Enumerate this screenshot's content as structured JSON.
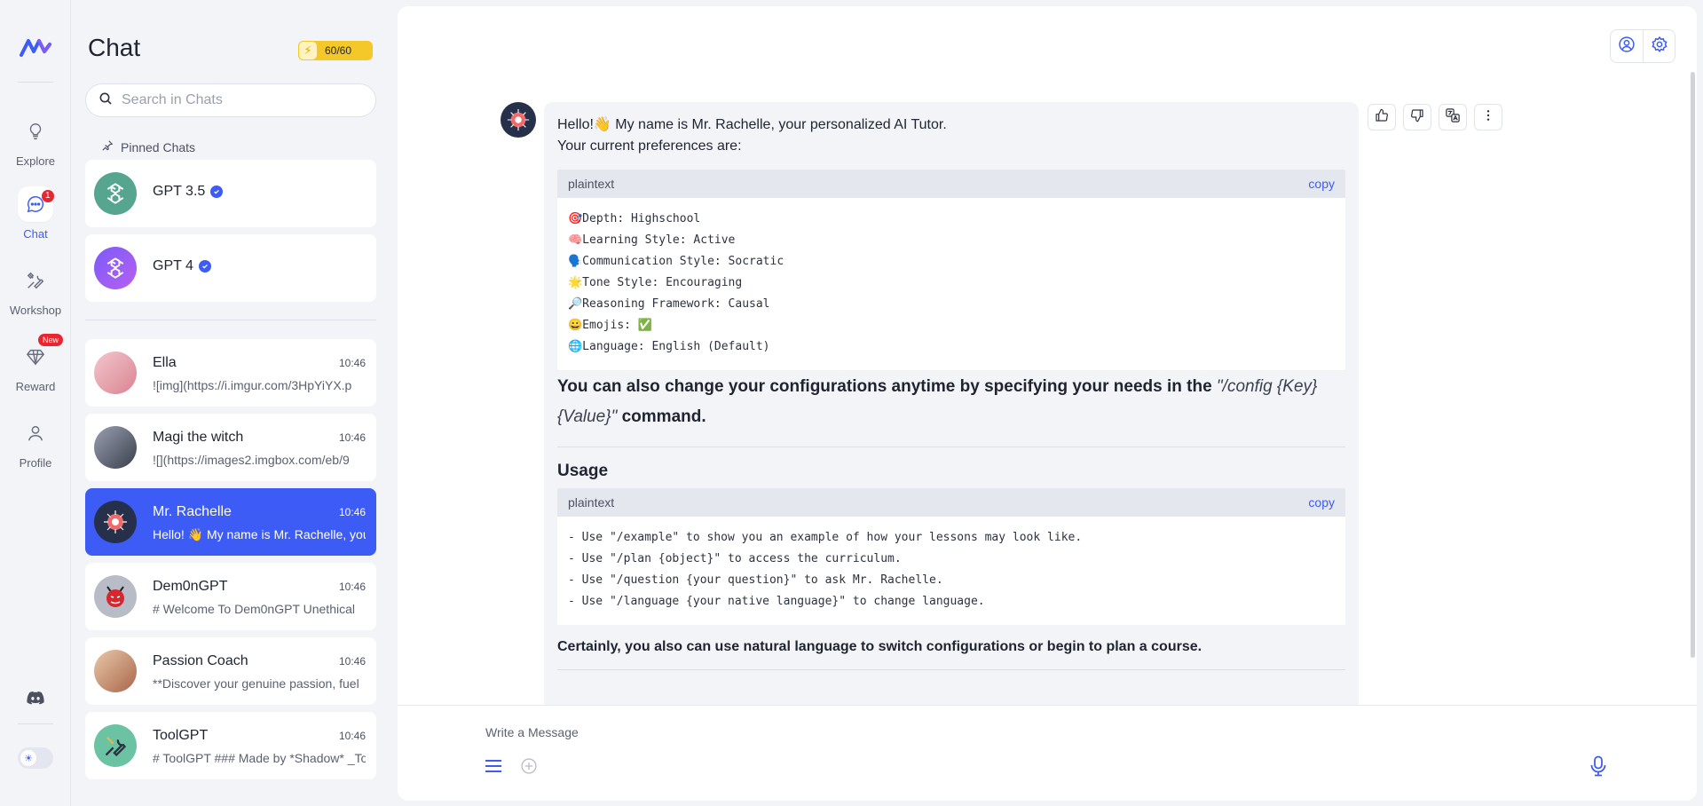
{
  "brand": {
    "logo": "app-logo",
    "accent": "#3d5bf5"
  },
  "rail": {
    "items": [
      {
        "label": "Explore",
        "icon": "lightbulb-icon"
      },
      {
        "label": "Chat",
        "icon": "chat-bubble-icon",
        "badge": "1"
      },
      {
        "label": "Workshop",
        "icon": "tools-icon"
      },
      {
        "label": "Reward",
        "icon": "diamond-icon",
        "badge": "New"
      },
      {
        "label": "Profile",
        "icon": "user-icon"
      }
    ],
    "discord_icon": "discord-icon",
    "theme_icon": "sun-icon"
  },
  "panel": {
    "title": "Chat",
    "quota": "60/60",
    "search_placeholder": "Search in Chats",
    "pinned_label": "Pinned Chats",
    "pinned": [
      {
        "name": "GPT 3.5",
        "verified": true
      },
      {
        "name": "GPT 4",
        "verified": true
      }
    ],
    "chats": [
      {
        "name": "Ella",
        "time": "10:46",
        "preview": "![img](https://i.imgur.com/3HpYiYX.p"
      },
      {
        "name": "Magi the witch",
        "time": "10:46",
        "preview": "![](https://images2.imgbox.com/eb/9"
      },
      {
        "name": "Mr. Rachelle",
        "time": "10:46",
        "preview": "Hello! 👋 My name is Mr. Rachelle, you",
        "active": true
      },
      {
        "name": "Dem0nGPT",
        "time": "10:46",
        "preview": "# Welcome To Dem0nGPT Unethical"
      },
      {
        "name": "Passion Coach",
        "time": "10:46",
        "preview": "**Discover your genuine passion, fuel"
      },
      {
        "name": "ToolGPT",
        "time": "10:46",
        "preview": "# ToolGPT ### Made by *Shadow* _To"
      }
    ]
  },
  "message": {
    "greeting_line1": "Hello!👋 My name is Mr. Rachelle, your personalized AI Tutor.",
    "greeting_line2": "Your current preferences are:",
    "block1_lang": "plaintext",
    "copy_label": "copy",
    "prefs": [
      "🎯Depth: Highschool",
      "🧠Learning Style: Active",
      "🗣️Communication Style: Socratic",
      "🌟Tone Style: Encouraging",
      "🔎Reasoning Framework: Causal",
      "😀Emojis: ✅",
      "🌐Language: English (Default)"
    ],
    "config_text_before": "You can also change your configurations anytime by specifying your needs in the ",
    "config_command": "\"/config {Key} {Value}\"",
    "config_text_after": " command.",
    "usage_heading": "Usage",
    "block2_lang": "plaintext",
    "usage_lines": [
      "- Use \"/example\" to show you an example of how your lessons may look like.",
      "- Use \"/plan {object}\" to access the curriculum.",
      "- Use \"/question {your question}\" to ask Mr. Rachelle.",
      "- Use \"/language {your native language}\" to change language."
    ],
    "closing": "Certainly, you also can use natural language to switch configurations or begin to plan a course."
  },
  "composer": {
    "placeholder": "Write a Message"
  }
}
